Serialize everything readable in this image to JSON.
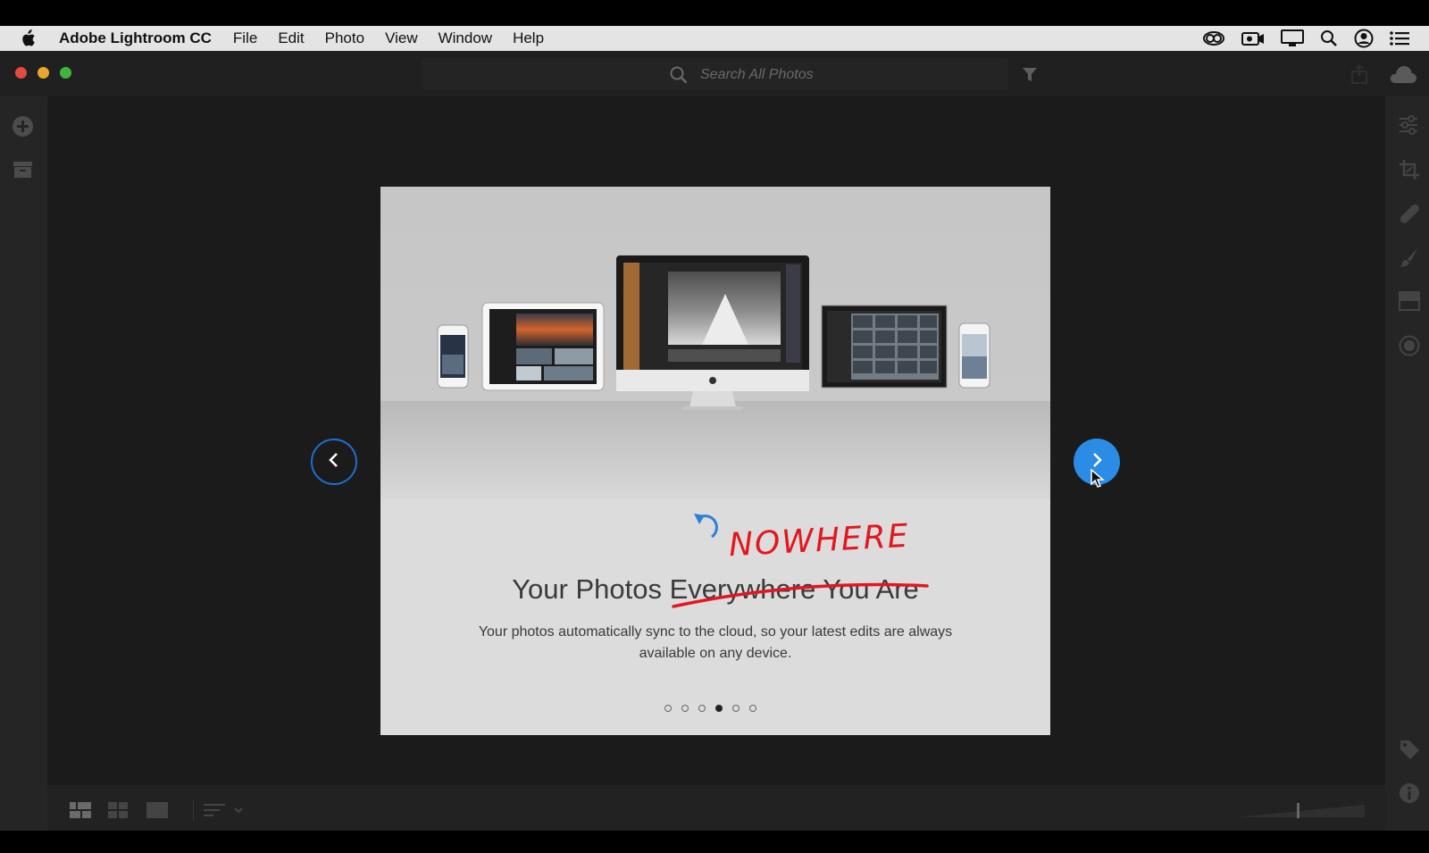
{
  "menubar": {
    "app_name": "Adobe Lightroom CC",
    "menus": [
      "File",
      "Edit",
      "Photo",
      "View",
      "Window",
      "Help"
    ]
  },
  "search": {
    "placeholder": "Search All Photos"
  },
  "onboarding": {
    "headline": "Your Photos Everywhere You Are",
    "annotation": "NOWHERE",
    "body": "Your photos automatically sync to the cloud, so your latest edits are always available on any device.",
    "slide_count": 6,
    "current_slide": 4
  },
  "colors": {
    "accent_blue": "#2b8ce6",
    "annotation_red": "#e4161f",
    "sync_icon": "#2f7fd6"
  },
  "icons": {
    "left_panel": [
      "add-photos-icon",
      "archive-icon"
    ],
    "right_panel": [
      "edit-sliders-icon",
      "crop-icon",
      "healing-brush-icon",
      "brush-icon",
      "linear-gradient-icon",
      "radial-gradient-icon",
      "tag-icon",
      "info-icon"
    ],
    "bottom_bar": [
      "square-grid-view-icon",
      "photo-grid-view-icon",
      "detail-view-icon",
      "sort-icon",
      "thumbnail-size-slider"
    ]
  }
}
